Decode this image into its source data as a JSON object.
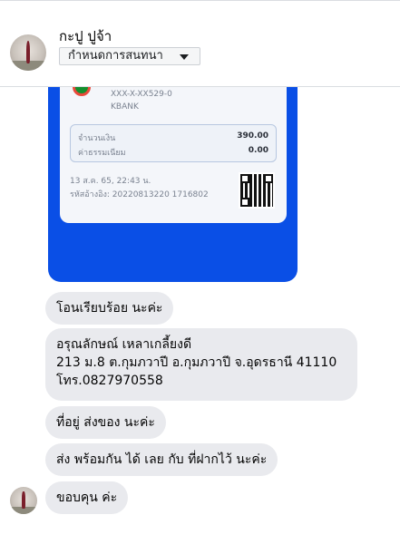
{
  "header": {
    "contact_name": "กะปู ปูจ้า",
    "nickname_button": "กำหนดการสนทนา"
  },
  "receipt": {
    "account": "XXX-X-XX529-0",
    "bank": "KBANK",
    "amount_label": "จำนวนเงิน",
    "amount_value": "390.00",
    "fee_label": "ค่าธรรมเนียม",
    "fee_value": "0.00",
    "datetime": "13 ส.ค. 65, 22:43 น.",
    "reference": "รหัสอ้างอิง: 20220813220 1716802",
    "colors": {
      "background": "#0a4fe6",
      "card": "#f4f6fa"
    }
  },
  "messages": [
    {
      "text": "โอนเรียบร้อย นะค่ะ"
    },
    {
      "lines": [
        "อรุณลักษณ์ เหลาเกลี้ยงดี",
        "213 ม.8 ต.กุมภวาปี อ.กุมภวาปี จ.อุดรธานี 41110",
        "โทร.0827970558"
      ]
    },
    {
      "text": "ที่อยู่ ส่งของ นะค่ะ"
    },
    {
      "text": "ส่ง พร้อมกัน ได้ เลย กับ ที่ฝากไว้ นะค่ะ"
    },
    {
      "text": "ขอบคุน ค่ะ"
    }
  ]
}
